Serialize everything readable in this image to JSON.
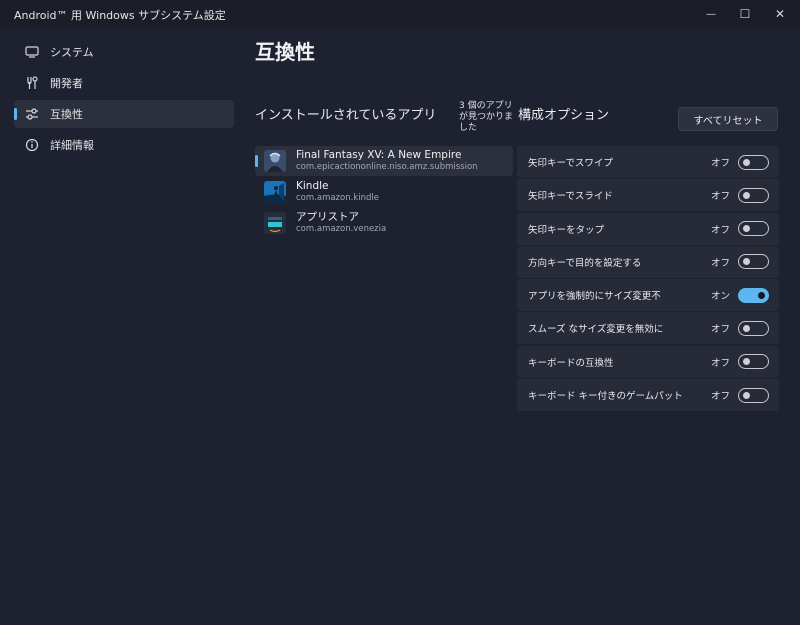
{
  "window": {
    "title": "Android™ 用 Windows サブシステム設定",
    "minimize_glyph": "—",
    "maximize_glyph": "☐",
    "close_glyph": "✕"
  },
  "sidebar": {
    "items": [
      {
        "label": "システム",
        "icon": "monitor-icon",
        "active": false
      },
      {
        "label": "開発者",
        "icon": "tools-icon",
        "active": false
      },
      {
        "label": "互換性",
        "icon": "sliders-icon",
        "active": true
      },
      {
        "label": "詳細情報",
        "icon": "info-icon",
        "active": false
      }
    ]
  },
  "main": {
    "title": "互換性",
    "apps_heading": "インストールされているアプリ",
    "apps_found": "3 個のアプリが見つかりました",
    "options_heading": "構成オプション",
    "reset_label": "すべてリセット",
    "apps": [
      {
        "name": "Final Fantasy XV: A New Empire",
        "package": "com.epicactiononline.niso.amz.submission",
        "icon": "final-fantasy-app-icon",
        "selected": true
      },
      {
        "name": "Kindle",
        "package": "com.amazon.kindle",
        "icon": "kindle-app-icon",
        "selected": false
      },
      {
        "name": "アプリストア",
        "package": "com.amazon.venezia",
        "icon": "appstore-app-icon",
        "selected": false
      }
    ],
    "options": [
      {
        "label": "矢印キーでスワイプ",
        "state": "オフ",
        "on": false
      },
      {
        "label": "矢印キーでスライド",
        "state": "オフ",
        "on": false
      },
      {
        "label": "矢印キーをタップ",
        "state": "オフ",
        "on": false
      },
      {
        "label": "方向キーで目的を設定する",
        "state": "オフ",
        "on": false
      },
      {
        "label": "アプリを強制的にサイズ変更不",
        "state": "オン",
        "on": true
      },
      {
        "label": "スムーズ なサイズ変更を無効に",
        "state": "オフ",
        "on": false
      },
      {
        "label": "キーボードの互換性",
        "state": "オフ",
        "on": false
      },
      {
        "label": "キーボード キー付きのゲームパット",
        "state": "オフ",
        "on": false
      }
    ]
  },
  "colors": {
    "background": "#1e2230",
    "accent": "#5eb6f0",
    "card": "#272b38"
  }
}
